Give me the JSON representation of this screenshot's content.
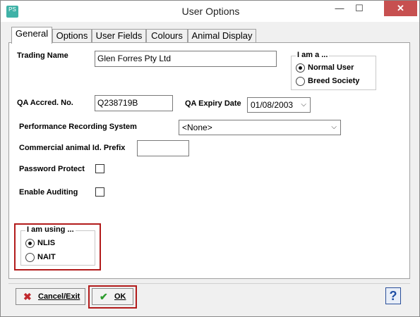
{
  "window": {
    "title": "User Options",
    "app_icon_text": "PS",
    "minimize_glyph": "—",
    "maximize_glyph": "☐",
    "close_glyph": "✕"
  },
  "tabs": [
    {
      "label": "General",
      "active": true
    },
    {
      "label": "Options",
      "active": false
    },
    {
      "label": "User Fields",
      "active": false
    },
    {
      "label": "Colours",
      "active": false
    },
    {
      "label": "Animal Display",
      "active": false
    }
  ],
  "general": {
    "trading_name_label": "Trading Name",
    "trading_name_value": "Glen Forres Pty Ltd",
    "qa_accred_label": "QA Accred. No.",
    "qa_accred_value": "Q238719B",
    "qa_expiry_label": "QA Expiry Date",
    "qa_expiry_value": "01/08/2003",
    "performance_label": "Performance Recording System",
    "performance_value": "<None>",
    "commercial_prefix_label": "Commercial animal Id. Prefix",
    "commercial_prefix_value": "",
    "password_protect_label": "Password Protect",
    "enable_auditing_label": "Enable Auditing"
  },
  "i_am_a": {
    "title": "I am a ...",
    "options": [
      {
        "label": "Normal User",
        "selected": true
      },
      {
        "label": "Breed Society",
        "selected": false
      }
    ]
  },
  "i_am_using": {
    "title": "I am using ...",
    "options": [
      {
        "label": "NLIS",
        "selected": true
      },
      {
        "label": "NAIT",
        "selected": false
      }
    ]
  },
  "buttons": {
    "cancel_label": "Cancel/Exit",
    "ok_label": "OK",
    "help_label": "?"
  },
  "colors": {
    "highlight": "#b21b1b",
    "close_button": "#c75050",
    "cancel_icon": "#c0282d",
    "ok_icon": "#2e9c2e"
  }
}
